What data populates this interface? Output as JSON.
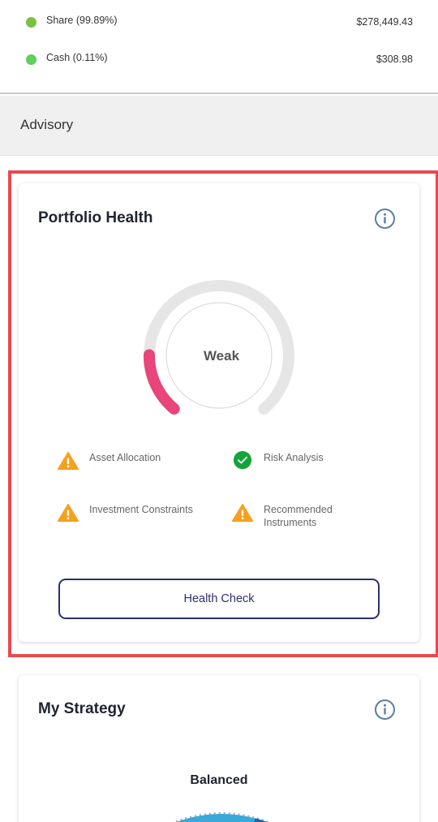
{
  "assets": [
    {
      "label": "Share (99.89%)",
      "value": "$278,449.43",
      "color": "#7ac142"
    },
    {
      "label": "Cash (0.11%)",
      "value": "$308.98",
      "color": "#5ed05e"
    }
  ],
  "advisory": {
    "title": "Advisory"
  },
  "portfolio_health": {
    "title": "Portfolio Health",
    "info_icon": "info-icon",
    "status": "Weak",
    "progress": 0.18,
    "status_color": "#e8457a",
    "items": [
      {
        "label": "Asset Allocation",
        "state": "warning"
      },
      {
        "label": "Risk Analysis",
        "state": "ok"
      },
      {
        "label": "Investment Constraints",
        "state": "warning"
      },
      {
        "label": "Recommended Instruments",
        "state": "warning"
      }
    ],
    "button_label": "Health Check"
  },
  "strategy": {
    "title": "My Strategy",
    "info_icon": "info-icon",
    "profile": "Balanced"
  },
  "colors": {
    "warning": "#f4a21e",
    "ok": "#13a538",
    "accent": "#2c2f6b",
    "highlight": "#e8494f"
  }
}
